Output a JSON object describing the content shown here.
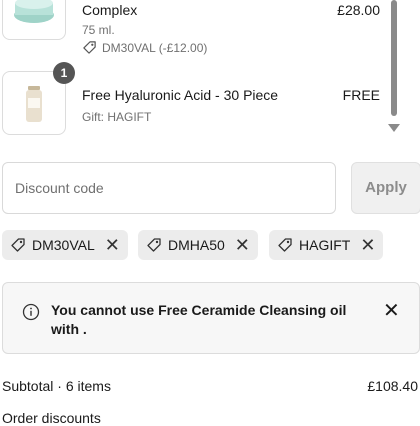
{
  "items": [
    {
      "name": "Complex",
      "size": "75 ml.",
      "discount": "DM30VAL (-£12.00)",
      "price": "£28.00"
    },
    {
      "quantity": "1",
      "name": "Free Hyaluronic Acid - 30 Piece",
      "gift": "Gift: HAGIFT",
      "price": "FREE"
    }
  ],
  "discount": {
    "placeholder": "Discount code",
    "apply_label": "Apply",
    "chips": [
      {
        "code": "DM30VAL"
      },
      {
        "code": "DMHA50"
      },
      {
        "code": "HAGIFT"
      }
    ]
  },
  "alert": {
    "message": "You cannot use Free Ceramide Cleansing oil with ."
  },
  "summary": {
    "subtotal_label": "Subtotal · 6 items",
    "subtotal_value": "£108.40",
    "order_discounts_label": "Order discounts"
  },
  "icons": {
    "tag": "tag-icon",
    "info": "info-icon",
    "close": "close-icon",
    "remove": "remove-x-icon"
  }
}
